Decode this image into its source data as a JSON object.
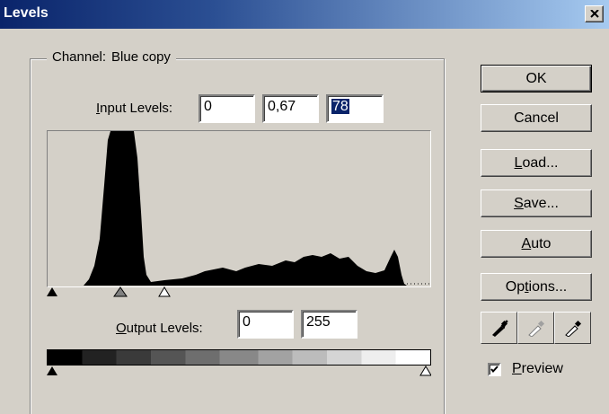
{
  "window": {
    "title": "Levels"
  },
  "channel": {
    "label": "Channel:",
    "value": "Blue copy"
  },
  "input_levels": {
    "label_prefix": "I",
    "label_rest": "nput Levels:",
    "black": "0",
    "gamma": "0,67",
    "white": "78"
  },
  "output_levels": {
    "label_prefix": "O",
    "label_rest": "utput Levels:",
    "black": "0",
    "white": "255"
  },
  "buttons": {
    "ok": "OK",
    "cancel": "Cancel",
    "load_prefix": "L",
    "load_rest": "oad...",
    "save_prefix": "S",
    "save_rest": "ave...",
    "auto_prefix": "A",
    "auto_rest": "uto",
    "options_a": "Op",
    "options_u": "t",
    "options_b": "ions..."
  },
  "preview": {
    "prefix": "P",
    "rest": "review",
    "checked": true
  },
  "icons": [
    "close-icon",
    "black-eyedropper-icon",
    "gray-eyedropper-icon",
    "white-eyedropper-icon",
    "checkmark-icon"
  ]
}
